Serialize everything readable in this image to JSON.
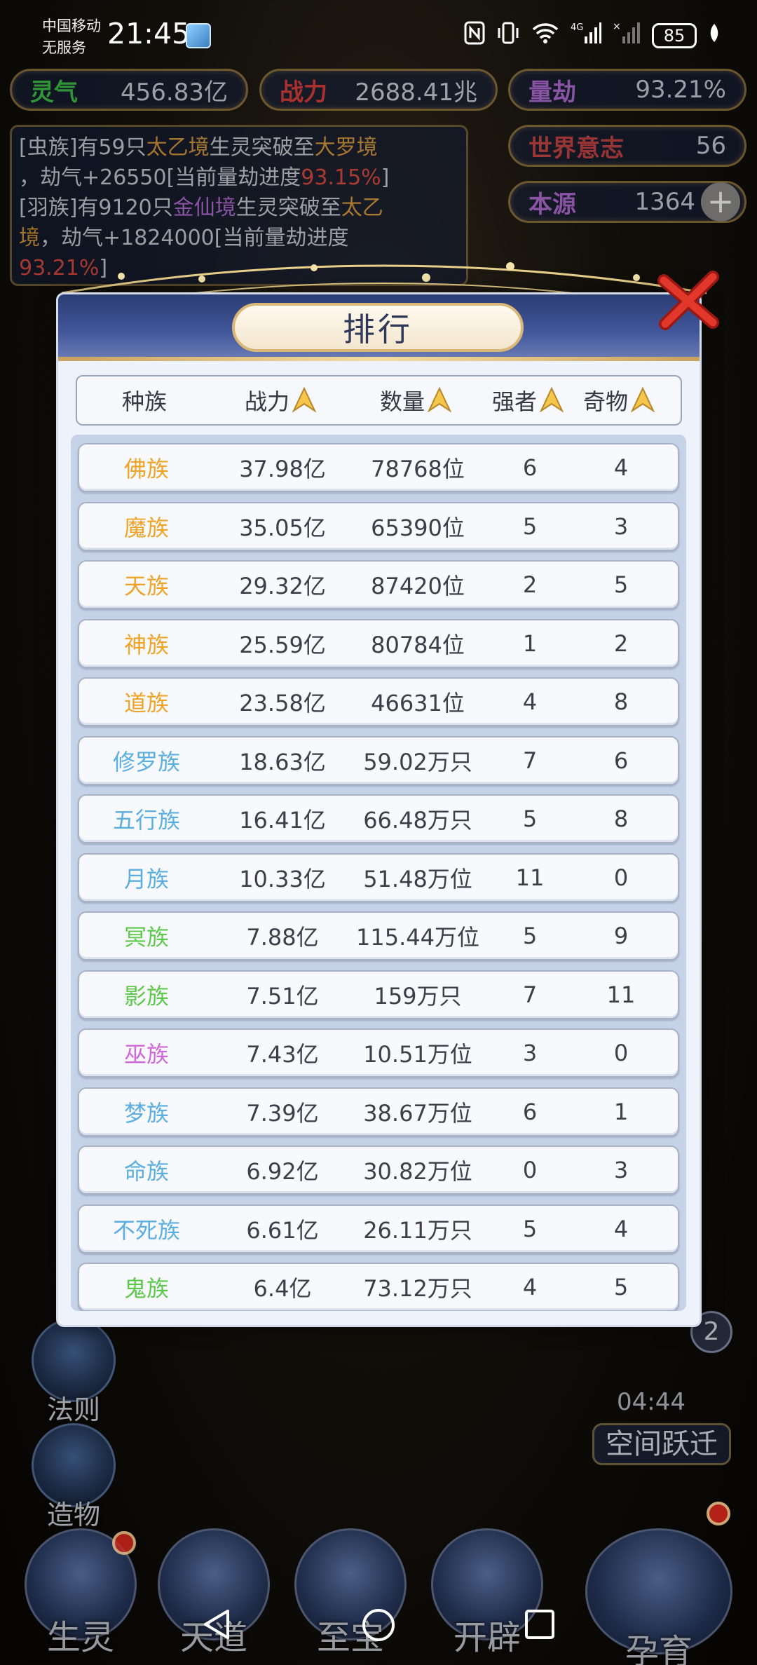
{
  "status_bar": {
    "carrier_line1": "中国移动",
    "carrier_line2": "无服务",
    "time": "21:45",
    "network": "4G",
    "battery": "85"
  },
  "hud": {
    "lingqi_label": "灵气",
    "lingqi_value": "456.83亿",
    "zhanli_label": "战力",
    "zhanli_value": "2688.41兆",
    "liangjie_label": "量劫",
    "liangjie_value": "93.21%",
    "yizhi_label": "世界意志",
    "yizhi_value": "56",
    "benyuan_label": "本源",
    "benyuan_value": "1364",
    "plus": "+"
  },
  "log": {
    "l1_a": "[虫族]有59只",
    "l1_b": "太乙境",
    "l1_c": "生灵突破至",
    "l1_d": "大罗境",
    "l2_a": "，劫气+26550[当前量劫进度",
    "l2_b": "93.15%",
    "l2_c": "]",
    "l3_a": "[羽族]有9120只",
    "l3_b": "金仙境",
    "l3_c": "生灵突破至",
    "l3_d": "太乙",
    "l4_a": "境",
    "l4_b": "，劫气+1824000[当前量劫进度",
    "l5_a": "93.21%",
    "l5_b": "]"
  },
  "side_buttons": {
    "fa_ze": "法则",
    "zao_wu": "造物",
    "kong_jian": "空间跃迁",
    "timer": "04:44",
    "badge": "2"
  },
  "bottom_nav": {
    "sheng_ling": "生灵",
    "tian_dao": "天道",
    "zhi_bao": "至宝",
    "kai_pi": "开辟",
    "yun_yu": "孕育"
  },
  "modal": {
    "title": "排行",
    "columns": [
      "种族",
      "战力",
      "数量",
      "强者",
      "奇物"
    ],
    "rows": [
      {
        "name": "佛族",
        "power": "37.98亿",
        "count": "78768位",
        "strong": "6",
        "items": "4",
        "color": "#f0a326"
      },
      {
        "name": "魔族",
        "power": "35.05亿",
        "count": "65390位",
        "strong": "5",
        "items": "3",
        "color": "#f0a326"
      },
      {
        "name": "天族",
        "power": "29.32亿",
        "count": "87420位",
        "strong": "2",
        "items": "5",
        "color": "#f0a326"
      },
      {
        "name": "神族",
        "power": "25.59亿",
        "count": "80784位",
        "strong": "1",
        "items": "2",
        "color": "#f0a326"
      },
      {
        "name": "道族",
        "power": "23.58亿",
        "count": "46631位",
        "strong": "4",
        "items": "8",
        "color": "#f0a326"
      },
      {
        "name": "修罗族",
        "power": "18.63亿",
        "count": "59.02万只",
        "strong": "7",
        "items": "6",
        "color": "#5aaee0"
      },
      {
        "name": "五行族",
        "power": "16.41亿",
        "count": "66.48万只",
        "strong": "5",
        "items": "8",
        "color": "#5aaee0"
      },
      {
        "name": "月族",
        "power": "10.33亿",
        "count": "51.48万位",
        "strong": "11",
        "items": "0",
        "color": "#5aaee0"
      },
      {
        "name": "冥族",
        "power": "7.88亿",
        "count": "115.44万位",
        "strong": "5",
        "items": "9",
        "color": "#5cc94a"
      },
      {
        "name": "影族",
        "power": "7.51亿",
        "count": "159万只",
        "strong": "7",
        "items": "11",
        "color": "#5cc94a"
      },
      {
        "name": "巫族",
        "power": "7.43亿",
        "count": "10.51万位",
        "strong": "3",
        "items": "0",
        "color": "#d067d8"
      },
      {
        "name": "梦族",
        "power": "7.39亿",
        "count": "38.67万位",
        "strong": "6",
        "items": "1",
        "color": "#5aaee0"
      },
      {
        "name": "命族",
        "power": "6.92亿",
        "count": "30.82万位",
        "strong": "0",
        "items": "3",
        "color": "#5aaee0"
      },
      {
        "name": "不死族",
        "power": "6.61亿",
        "count": "26.11万只",
        "strong": "5",
        "items": "4",
        "color": "#5aaee0"
      },
      {
        "name": "鬼族",
        "power": "6.4亿",
        "count": "73.12万只",
        "strong": "4",
        "items": "5",
        "color": "#5cc94a"
      }
    ]
  },
  "colors": {
    "lingqi": "#3fc24a",
    "zhanli": "#d83a3a",
    "liangjie": "#b06bd6",
    "yizhi": "#c64242",
    "benyuan": "#b06bd6"
  }
}
